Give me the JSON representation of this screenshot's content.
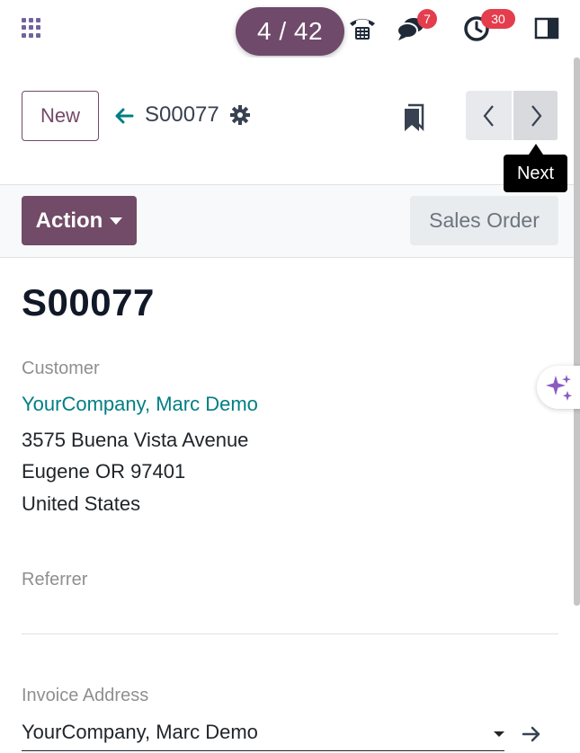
{
  "navbar": {
    "pager_counter": "4 / 42",
    "messages_badge": "7",
    "activities_badge": "30",
    "icons": {
      "apps": "apps-grid-icon",
      "phone": "phone-icon",
      "messages": "chat-icon",
      "activities": "clock-icon",
      "panel": "split-panel-icon"
    }
  },
  "control_panel": {
    "new_label": "New",
    "breadcrumb_title": "S00077",
    "tooltip": "Next"
  },
  "statusbar": {
    "action_label": "Action",
    "stage_label": "Sales Order"
  },
  "form": {
    "record_name": "S00077",
    "customer_label": "Customer",
    "customer_name": "YourCompany, Marc Demo",
    "address_lines": [
      "3575 Buena Vista Avenue",
      "Eugene OR 97401",
      "United States"
    ],
    "referrer_label": "Referrer",
    "invoice_address_label": "Invoice Address",
    "invoice_address_value": "YourCompany, Marc Demo"
  },
  "colors": {
    "brand": "#714b67",
    "link": "#017e84",
    "badge": "#e43d4d"
  }
}
